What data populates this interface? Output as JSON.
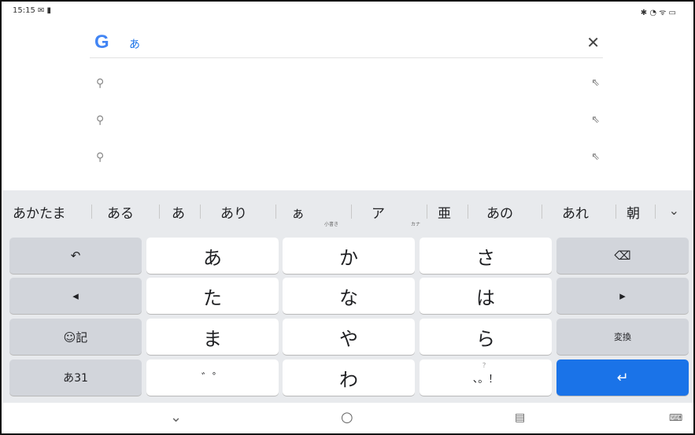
{
  "status": {
    "time": "15:15 ✉ ▮",
    "right": "✱ ◔ ᯤ ▭"
  },
  "search": {
    "logo": "G",
    "query": "あ",
    "clear": "✕"
  },
  "suggestions": [
    {
      "icon": "⚲",
      "action": "⇖"
    },
    {
      "icon": "⚲",
      "action": "⇖"
    },
    {
      "icon": "⚲",
      "action": "⇖"
    }
  ],
  "candidates": {
    "items": [
      "あかたま",
      "ある",
      "あ",
      "あり",
      "ぁ",
      "ア",
      "亜",
      "あの",
      "あれ",
      "朝"
    ],
    "sub_small": "小書き",
    "sub_kana": "カナ",
    "expand": "⌄"
  },
  "keys": {
    "undo": "↶",
    "row1": [
      "あ",
      "か",
      "さ"
    ],
    "backspace": "⌫",
    "left": "◂",
    "row2": [
      "た",
      "な",
      "は"
    ],
    "right": "▸",
    "emoji": "☺記",
    "row3": [
      "ま",
      "や",
      "ら"
    ],
    "convert": "変換",
    "mode": "あ31",
    "dakuten": "゛゜",
    "wa": "わ",
    "punct_hint": "？",
    "punct": "、。！",
    "enter": "↵"
  },
  "nav": {
    "back": "⌄",
    "home": "○",
    "recent": "▤",
    "keyboard": "⌨"
  }
}
